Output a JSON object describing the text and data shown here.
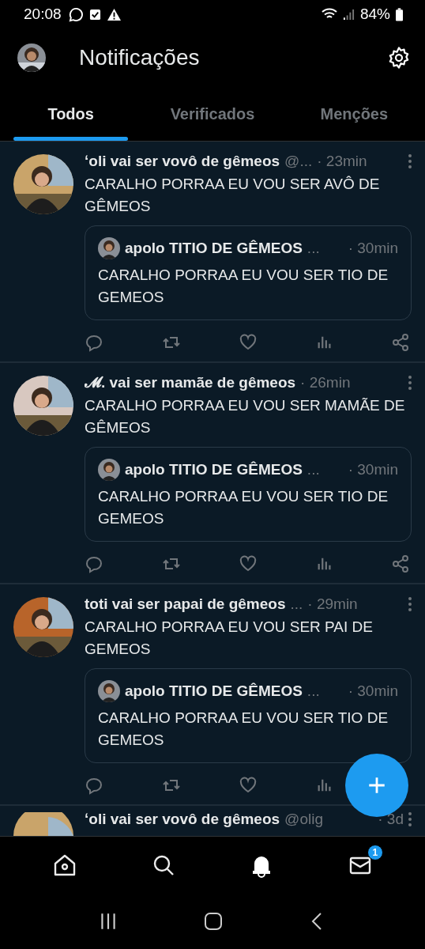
{
  "status_bar": {
    "time": "20:08",
    "battery": "84%"
  },
  "header": {
    "title": "Notificações"
  },
  "tabs": [
    {
      "label": "Todos",
      "selected": true
    },
    {
      "label": "Verificados",
      "selected": false
    },
    {
      "label": "Menções",
      "selected": false
    }
  ],
  "posts": [
    {
      "author": "ʻoli vai ser vovô de gêmeos",
      "handle": "@...",
      "time": "· 23min",
      "text": "CARALHO PORRAA EU VOU SER AVÔ DE GÊMEOS",
      "quote": {
        "author": "apolo TITIO DE GÊMEOS",
        "handle": "...",
        "time": "· 30min",
        "text": "CARALHO PORRAA EU VOU SER TIO DE GEMEOS"
      }
    },
    {
      "author": "𝓜. vai ser mamãe de gêmeos",
      "time": "· 26min",
      "text": "CARALHO PORRAA EU VOU SER MAMÃE DE GÊMEOS",
      "quote": {
        "author": "apolo TITIO DE GÊMEOS",
        "handle": "...",
        "time": "· 30min",
        "text": "CARALHO PORRAA EU VOU SER TIO DE GEMEOS"
      }
    },
    {
      "author": "toti vai ser papai de gêmeos",
      "handle": "...",
      "time": "· 29min",
      "text": "CARALHO PORRAA EU VOU SER PAI DE GEMEOS",
      "quote": {
        "author": "apolo TITIO DE GÊMEOS",
        "handle": "...",
        "time": "· 30min",
        "text": "CARALHO PORRAA EU VOU SER TIO DE GEMEOS"
      }
    }
  ],
  "partial_post": {
    "author": "ʻoli vai ser vovô de gêmeos",
    "handle": "@olig",
    "time": "· 3d"
  },
  "bottom_nav": [
    {
      "kind": "home",
      "selected": false
    },
    {
      "kind": "search",
      "selected": false
    },
    {
      "kind": "bell",
      "selected": true
    },
    {
      "kind": "mail",
      "selected": false,
      "badge": "1"
    }
  ]
}
